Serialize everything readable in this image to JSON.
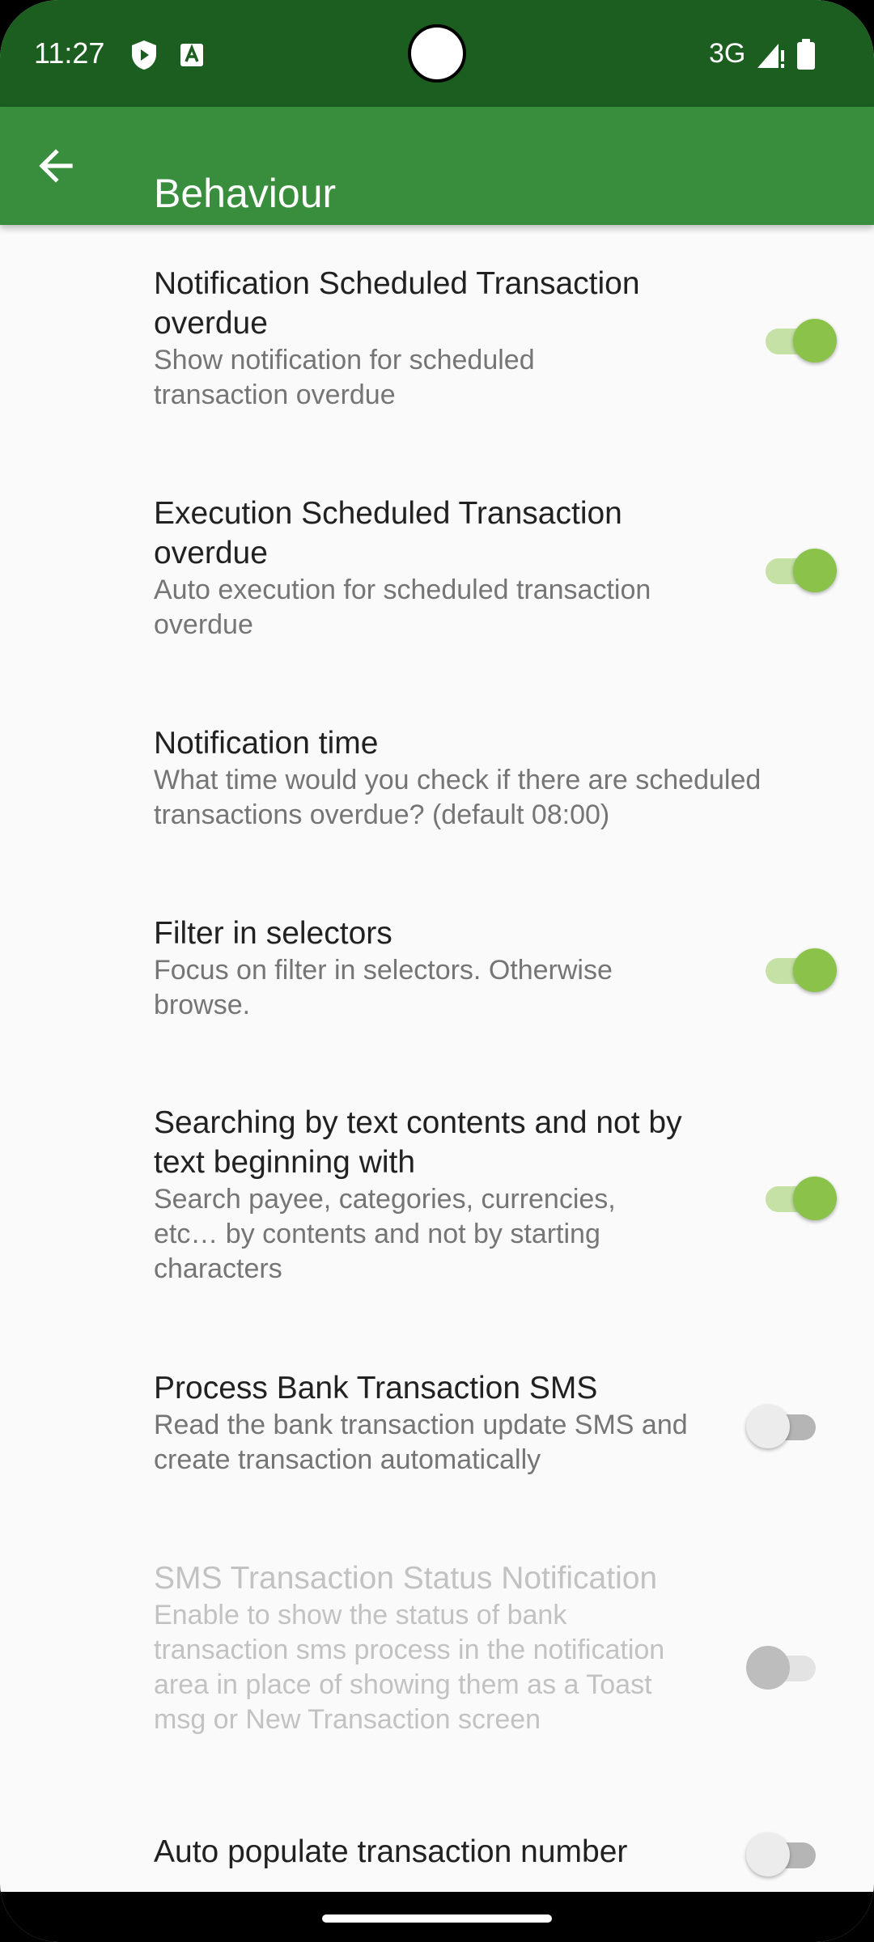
{
  "status_bar": {
    "time": "11:27",
    "network": "3G",
    "icons": [
      "shield-icon",
      "font-a-icon",
      "signal-icon",
      "battery-icon"
    ]
  },
  "app_bar": {
    "title": "Behaviour",
    "back_icon": "arrow-left-icon",
    "background_color": "#388e3c",
    "status_color": "#1b5e20"
  },
  "accent_color": "#8bc34a",
  "preferences": [
    {
      "title": "Notification Scheduled Transaction overdue",
      "summary": "Show notification for scheduled transaction overdue",
      "switch": "on",
      "enabled": true
    },
    {
      "title": "Execution Scheduled Transaction overdue",
      "summary": "Auto execution for scheduled transaction overdue",
      "switch": "on",
      "enabled": true
    },
    {
      "title": "Notification time",
      "summary": "What time would you check if there are scheduled transactions overdue? (default 08:00)",
      "switch": null,
      "enabled": true
    },
    {
      "title": "Filter in selectors",
      "summary": "Focus on filter in selectors. Otherwise browse.",
      "switch": "on",
      "enabled": true
    },
    {
      "title": "Searching by text contents and not by text beginning with",
      "summary": "Search payee, categories, currencies, etc… by contents and not by starting characters",
      "switch": "on",
      "enabled": true
    },
    {
      "title": "Process Bank Transaction SMS",
      "summary": "Read the bank transaction update SMS and create transaction automatically",
      "switch": "off",
      "enabled": true
    },
    {
      "title": "SMS Transaction Status Notification",
      "summary": "Enable to show the status of bank transaction sms process in the notification area in place of showing them as a Toast msg or New Transaction screen",
      "switch": "off",
      "enabled": false
    },
    {
      "title": "Auto populate transaction number",
      "summary": "",
      "switch": "off",
      "enabled": true
    }
  ]
}
